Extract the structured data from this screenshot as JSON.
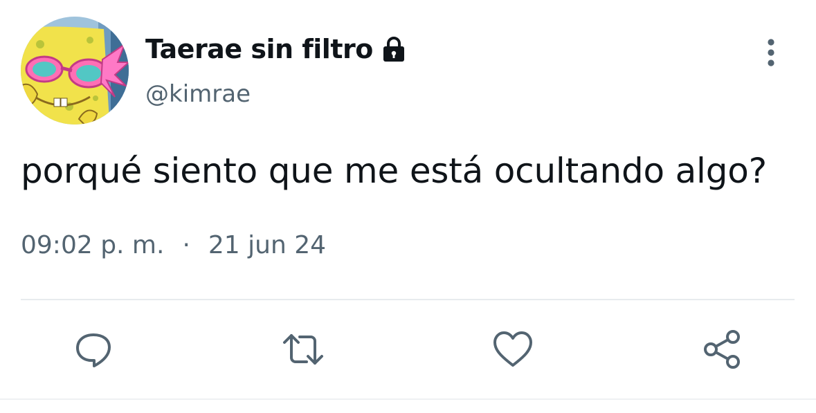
{
  "user": {
    "display_name": "Taerae sin filtro",
    "handle": "@kimrae",
    "avatar_icon": "spongebob-avatar",
    "protected_icon": "lock-icon"
  },
  "tweet": {
    "text": "porqué siento que me está ocultando algo?",
    "time": "09:02 p. m.",
    "separator": "·",
    "date": "21 jun 24"
  },
  "actions": {
    "reply_icon": "reply-icon",
    "retweet_icon": "retweet-icon",
    "like_icon": "heart-icon",
    "share_icon": "share-icon",
    "more_icon": "more-vertical-icon"
  },
  "colors": {
    "text_primary": "#0f1419",
    "text_secondary": "#536471",
    "divider": "#e7ebee"
  }
}
